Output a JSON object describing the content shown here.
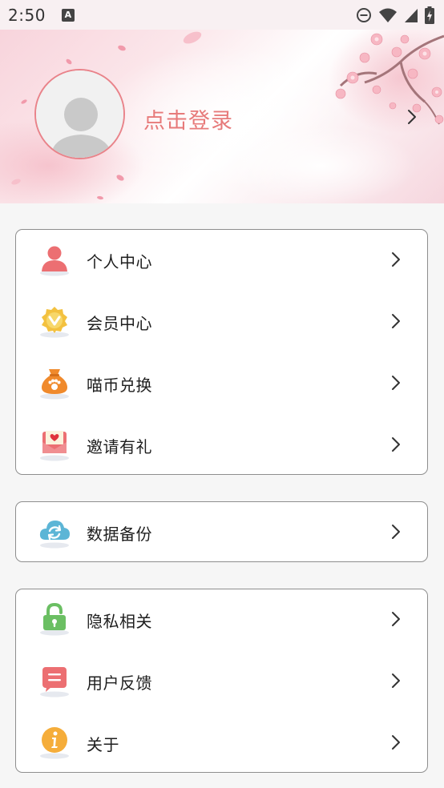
{
  "status_bar": {
    "time": "2:50",
    "notification_icon": "a-icon",
    "icons": [
      "do-not-disturb-icon",
      "wifi-icon",
      "signal-icon",
      "battery-charging-icon"
    ]
  },
  "header": {
    "login_text": "点击登录",
    "avatar_icon": "default-avatar-icon",
    "chevron_icon": "chevron-right-icon",
    "accent_color": "#e77a7a"
  },
  "groups": [
    {
      "items": [
        {
          "label": "个人中心",
          "icon": "person-icon"
        },
        {
          "label": "会员中心",
          "icon": "vip-badge-icon"
        },
        {
          "label": "喵币兑换",
          "icon": "coin-bag-icon"
        },
        {
          "label": "邀请有礼",
          "icon": "invite-envelope-icon"
        }
      ]
    },
    {
      "items": [
        {
          "label": "数据备份",
          "icon": "cloud-sync-icon"
        }
      ]
    },
    {
      "items": [
        {
          "label": "隐私相关",
          "icon": "lock-icon"
        },
        {
          "label": "用户反馈",
          "icon": "feedback-icon"
        },
        {
          "label": "关于",
          "icon": "info-icon"
        }
      ]
    }
  ]
}
